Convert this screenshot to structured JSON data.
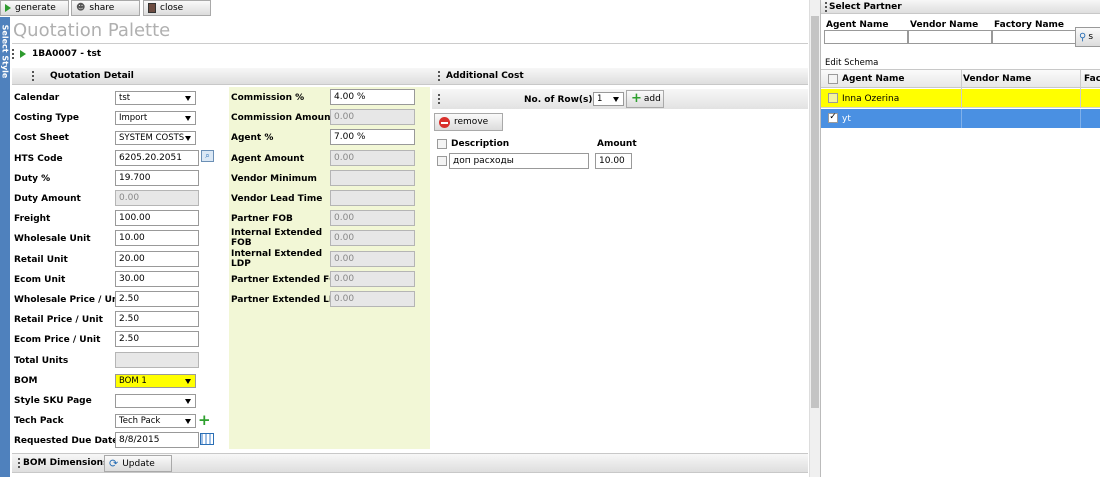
{
  "toolbar": {
    "generate": "generate",
    "share": "share",
    "close": "close"
  },
  "side_tab": "Select Style",
  "page_title": "Quotation Palette",
  "record_label": "1BA0007 - tst",
  "sections": {
    "quotation_detail": "Quotation Detail",
    "additional_cost": "Additional Cost",
    "bom_dimensions": "BOM Dimensions"
  },
  "left_fields": [
    {
      "label": "Calendar",
      "value": "tst",
      "kind": "select"
    },
    {
      "label": "Costing Type",
      "value": "Import",
      "kind": "select"
    },
    {
      "label": "Cost Sheet",
      "value": "SYSTEM COSTS",
      "kind": "select"
    },
    {
      "label": "HTS Code",
      "value": "6205.20.2051",
      "kind": "input"
    },
    {
      "label": "Duty %",
      "value": "19.700",
      "kind": "input"
    },
    {
      "label": "Duty Amount",
      "value": "0.00",
      "kind": "readonly"
    },
    {
      "label": "Freight",
      "value": "100.00",
      "kind": "input"
    },
    {
      "label": "Wholesale Unit",
      "value": "10.00",
      "kind": "input"
    },
    {
      "label": "Retail Unit",
      "value": "20.00",
      "kind": "input"
    },
    {
      "label": "Ecom Unit",
      "value": "30.00",
      "kind": "input"
    },
    {
      "label": "Wholesale Price / Unit",
      "value": "2.50",
      "kind": "input"
    },
    {
      "label": "Retail Price / Unit",
      "value": "2.50",
      "kind": "input"
    },
    {
      "label": "Ecom Price / Unit",
      "value": "2.50",
      "kind": "input"
    },
    {
      "label": "Total Units",
      "value": "",
      "kind": "readonly"
    },
    {
      "label": "BOM",
      "value": "BOM 1",
      "kind": "select-yellow"
    },
    {
      "label": "Style SKU Page",
      "value": "",
      "kind": "select"
    },
    {
      "label": "Tech Pack",
      "value": "Tech Pack",
      "kind": "select-plus"
    },
    {
      "label": "Requested Due Date",
      "value": "8/8/2015",
      "kind": "date"
    }
  ],
  "mid_fields": [
    {
      "label": "Commission %",
      "value": "4.00 %",
      "kind": "input"
    },
    {
      "label": "Commission Amount",
      "value": "0.00",
      "kind": "readonly"
    },
    {
      "label": "Agent %",
      "value": "7.00 %",
      "kind": "input"
    },
    {
      "label": "Agent Amount",
      "value": "0.00",
      "kind": "readonly"
    },
    {
      "label": "Vendor Minimum",
      "value": "",
      "kind": "readonly"
    },
    {
      "label": "Vendor Lead Time",
      "value": "",
      "kind": "readonly"
    },
    {
      "label": "Partner FOB",
      "value": "0.00",
      "kind": "readonly"
    },
    {
      "label": "Internal Extended FOB",
      "value": "0.00",
      "kind": "readonly"
    },
    {
      "label": "Internal Extended LDP",
      "value": "0.00",
      "kind": "readonly"
    },
    {
      "label": "Partner Extended FOB",
      "value": "0.00",
      "kind": "readonly"
    },
    {
      "label": "Partner Extended LDP",
      "value": "0.00",
      "kind": "readonly"
    }
  ],
  "additional_cost": {
    "rows_label": "No. of Row(s):",
    "rows_value": "1",
    "add_label": "add",
    "remove_label": "remove",
    "columns": [
      "Description",
      "Amount"
    ],
    "rows": [
      {
        "description": "доп расходы",
        "amount": "10.00"
      }
    ]
  },
  "update_label": "Update",
  "partner": {
    "title": "Select Partner",
    "filter_labels": [
      "Agent Name",
      "Vendor Name",
      "Factory Name"
    ],
    "search_label": "s",
    "edit_schema": "Edit Schema",
    "columns": [
      "Agent Name",
      "Vendor Name",
      "Fac"
    ],
    "rows": [
      {
        "agent": "Inna Ozerina",
        "checked": false,
        "style": "yellow"
      },
      {
        "agent": "yt",
        "checked": true,
        "style": "selected"
      }
    ]
  },
  "colors": {
    "accent_blue": "#4f81bd",
    "highlight_yellow": "#ffff00",
    "selected_row": "#4a90e2",
    "green_panel": "#f2f7d6"
  }
}
